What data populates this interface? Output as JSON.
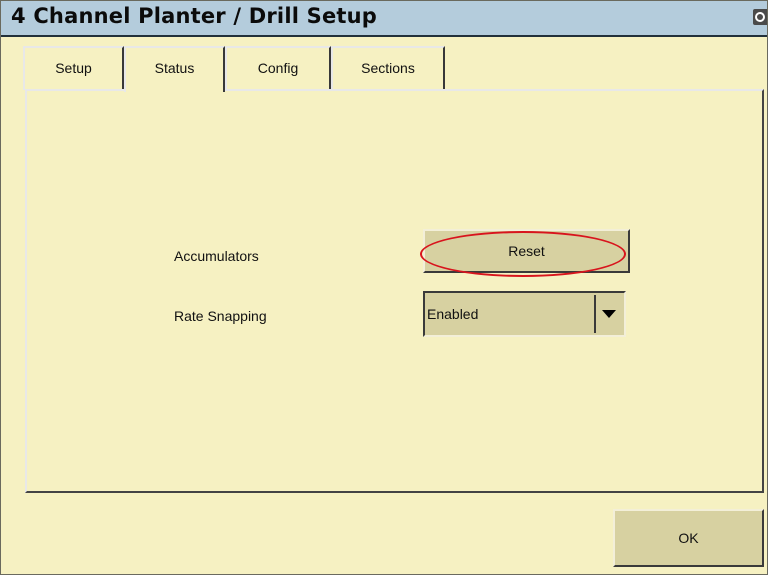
{
  "window": {
    "title": "4 Channel Planter / Drill Setup",
    "camera_icon": "camera-icon"
  },
  "tabs": [
    {
      "label": "Setup",
      "active": false
    },
    {
      "label": "Status",
      "active": true
    },
    {
      "label": "Config",
      "active": false
    },
    {
      "label": "Sections",
      "active": false
    }
  ],
  "status": {
    "accumulators_label": "Accumulators",
    "reset_label": "Reset",
    "rate_snapping_label": "Rate Snapping",
    "rate_snapping_value": "Enabled",
    "dropdown_icon": "dropdown-arrow-icon"
  },
  "footer": {
    "ok_label": "OK"
  },
  "colors": {
    "title_bar": "#b4ccdc",
    "panel_background": "#f6f1c2",
    "button_face": "#d7d1a1",
    "highlight_ring": "#d8141d"
  }
}
